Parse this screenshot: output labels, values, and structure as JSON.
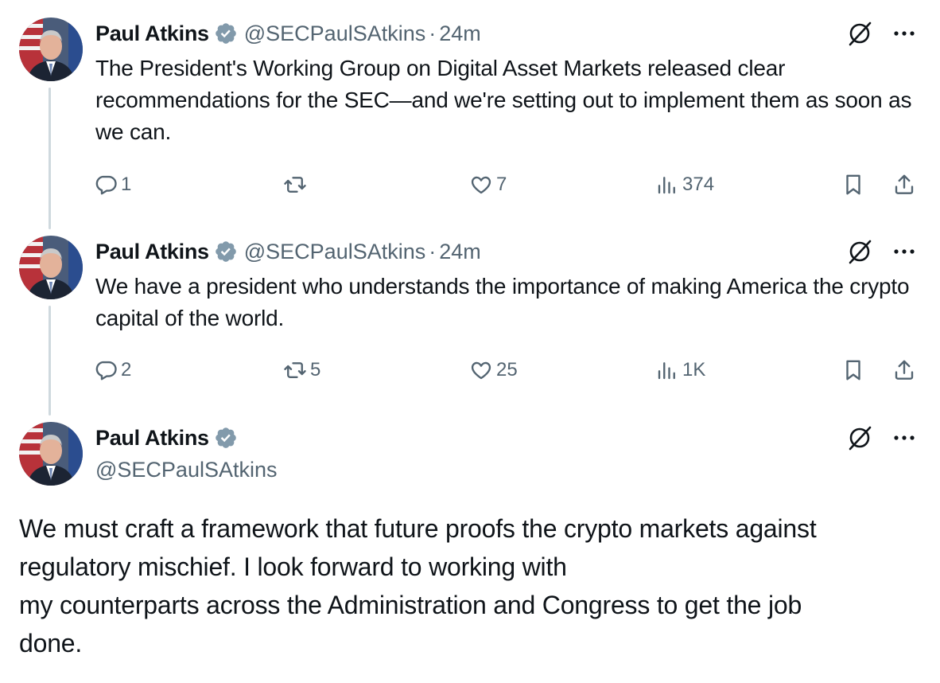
{
  "tweets": [
    {
      "author": "Paul Atkins",
      "handle": "@SECPaulSAtkins",
      "separator": "·",
      "time": "24m",
      "text": "The President's Working Group on Digital Asset Markets released clear recommendations for the SEC—and we're setting out to implement them as soon as we can.",
      "replies": "1",
      "retweets": "",
      "likes": "7",
      "views": "374"
    },
    {
      "author": "Paul Atkins",
      "handle": "@SECPaulSAtkins",
      "separator": "·",
      "time": "24m",
      "text": "We have a president who understands the importance of making America the crypto capital of the world.",
      "replies": "2",
      "retweets": "5",
      "likes": "25",
      "views": "1K"
    }
  ],
  "main_tweet": {
    "author": "Paul Atkins",
    "handle": "@SECPaulSAtkins",
    "text_lines": [
      "We must craft a framework that future proofs the crypto markets against",
      "regulatory mischief. I look forward to working with",
      "my counterparts across the Administration and Congress to get the job",
      "done."
    ]
  },
  "icons": {
    "verified": "verified-badge-icon",
    "grok": "grok-icon",
    "more": "more-icon",
    "reply": "reply-icon",
    "retweet": "retweet-icon",
    "like": "like-icon",
    "views": "views-icon",
    "bookmark": "bookmark-icon",
    "share": "share-icon"
  },
  "colors": {
    "text": "#0f1419",
    "secondary": "#536471",
    "thread_line": "#cfd9de",
    "verified_badge": "#829aab"
  }
}
